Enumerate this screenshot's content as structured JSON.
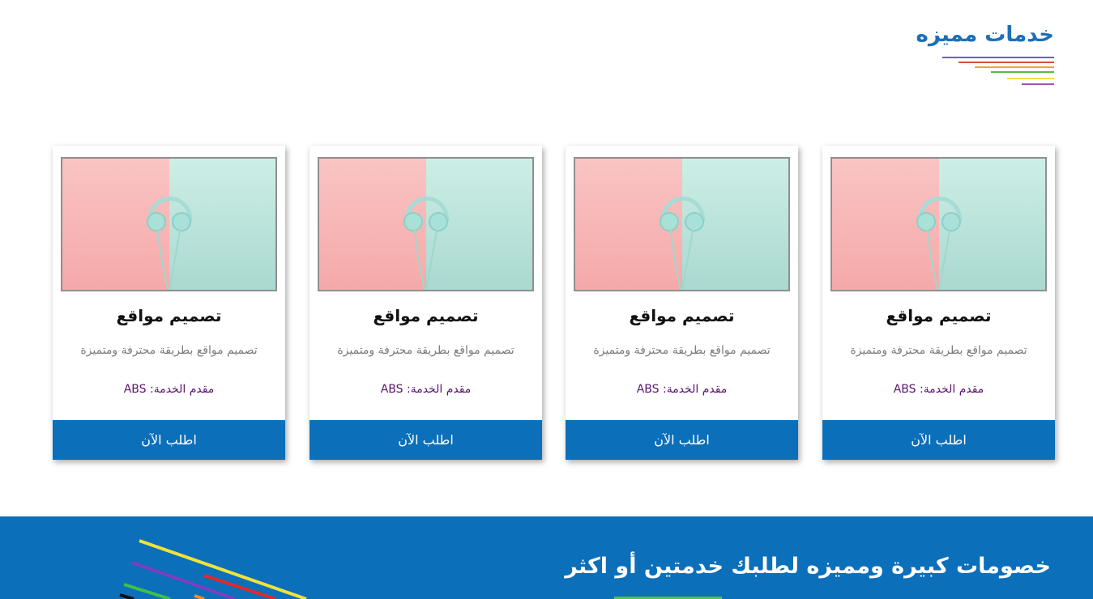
{
  "section": {
    "title": "خدمات مميزه",
    "accent_lines": [
      "#6b5bd6",
      "#e04b3c",
      "#f0a13a",
      "#f2e23a",
      "#5ab84b",
      "#a84dbd"
    ]
  },
  "cards": [
    {
      "title": "تصميم مواقع",
      "description": "تصميم مواقع بطريقة محترفة ومتميزة",
      "provider": "مقدم الخدمة: ABS",
      "button": "اطلب الآن",
      "image": "headphones-photo"
    },
    {
      "title": "تصميم مواقع",
      "description": "تصميم مواقع بطريقة محترفة ومتميزة",
      "provider": "مقدم الخدمة: ABS",
      "button": "اطلب الآن",
      "image": "headphones-photo"
    },
    {
      "title": "تصميم مواقع",
      "description": "تصميم مواقع بطريقة محترفة ومتميزة",
      "provider": "مقدم الخدمة: ABS",
      "button": "اطلب الآن",
      "image": "headphones-photo"
    },
    {
      "title": "تصميم مواقع",
      "description": "تصميم مواقع بطريقة محترفة ومتميزة",
      "provider": "مقدم الخدمة: ABS",
      "button": "اطلب الآن",
      "image": "headphones-photo"
    }
  ],
  "banner": {
    "title": "خصومات كبيرة ومميزه لطلبك خدمتين أو اكثر",
    "background": "#0b6fba",
    "stripe_colors": [
      "#f2e23a",
      "#7b3fbf",
      "#e02a2a",
      "#3fbf4a",
      "#111111",
      "#f08a2a"
    ]
  },
  "colors": {
    "primary": "#0b6fba",
    "title": "#1d6fb8",
    "provider": "#5b1470"
  }
}
